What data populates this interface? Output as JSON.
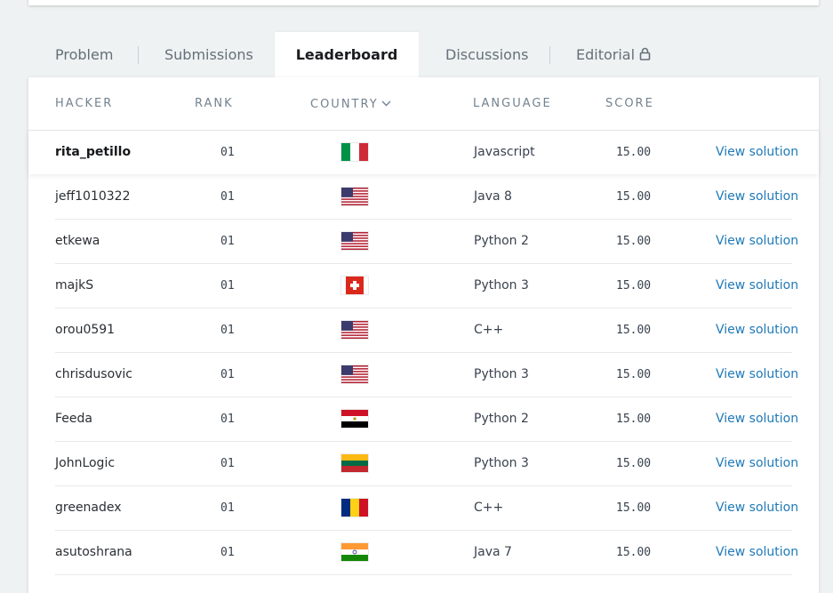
{
  "tabs": [
    {
      "label": "Problem"
    },
    {
      "label": "Submissions"
    },
    {
      "label": "Leaderboard",
      "active": true
    },
    {
      "label": "Discussions"
    },
    {
      "label": "Editorial",
      "icon": "lock-icon"
    }
  ],
  "table": {
    "headers": {
      "hacker": "HACKER",
      "rank": "RANK",
      "country": "COUNTRY",
      "language": "LANGUAGE",
      "score": "SCORE"
    },
    "sort_icon": "chevron-down-icon",
    "rows": [
      {
        "hacker": "rita_petillo",
        "rank": "01",
        "flag": "italy",
        "language": "Javascript",
        "score": "15.00",
        "action": "View solution"
      },
      {
        "hacker": "jeff1010322",
        "rank": "01",
        "flag": "usa",
        "language": "Java 8",
        "score": "15.00",
        "action": "View solution"
      },
      {
        "hacker": "etkewa",
        "rank": "01",
        "flag": "usa",
        "language": "Python 2",
        "score": "15.00",
        "action": "View solution"
      },
      {
        "hacker": "majkS",
        "rank": "01",
        "flag": "switzerland",
        "language": "Python 3",
        "score": "15.00",
        "action": "View solution"
      },
      {
        "hacker": "orou0591",
        "rank": "01",
        "flag": "usa",
        "language": "C++",
        "score": "15.00",
        "action": "View solution"
      },
      {
        "hacker": "chrisdusovic",
        "rank": "01",
        "flag": "usa",
        "language": "Python 3",
        "score": "15.00",
        "action": "View solution"
      },
      {
        "hacker": "Feeda",
        "rank": "01",
        "flag": "egypt",
        "language": "Python 2",
        "score": "15.00",
        "action": "View solution"
      },
      {
        "hacker": "JohnLogic",
        "rank": "01",
        "flag": "lithuania",
        "language": "Python 3",
        "score": "15.00",
        "action": "View solution"
      },
      {
        "hacker": "greenadex",
        "rank": "01",
        "flag": "romania",
        "language": "C++",
        "score": "15.00",
        "action": "View solution"
      },
      {
        "hacker": "asutoshrana",
        "rank": "01",
        "flag": "india",
        "language": "Java 7",
        "score": "15.00",
        "action": "View solution"
      }
    ]
  },
  "colors": {
    "page_bg": "#eef2f2",
    "link": "#1f7ab8",
    "header_text": "#738290"
  }
}
